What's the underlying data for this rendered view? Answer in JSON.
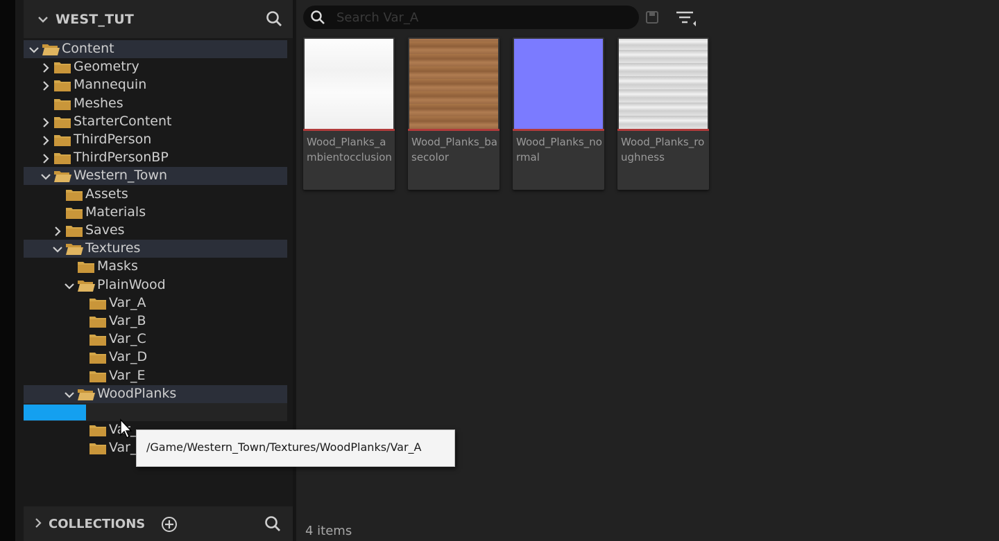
{
  "sidebar": {
    "title": "WEST_TUT",
    "tree": [
      {
        "label": "Content",
        "arrow": "down",
        "indent": 0,
        "open": true,
        "hl": true
      },
      {
        "label": "Geometry",
        "arrow": "right",
        "indent": 1
      },
      {
        "label": "Mannequin",
        "arrow": "right",
        "indent": 1
      },
      {
        "label": "Meshes",
        "arrow": "none",
        "indent": 1
      },
      {
        "label": "StarterContent",
        "arrow": "right",
        "indent": 1
      },
      {
        "label": "ThirdPerson",
        "arrow": "right",
        "indent": 1
      },
      {
        "label": "ThirdPersonBP",
        "arrow": "right",
        "indent": 1
      },
      {
        "label": "Western_Town",
        "arrow": "down",
        "indent": 1,
        "open": true,
        "hl": true
      },
      {
        "label": "Assets",
        "arrow": "none",
        "indent": 2
      },
      {
        "label": "Materials",
        "arrow": "none",
        "indent": 2
      },
      {
        "label": "Saves",
        "arrow": "right",
        "indent": 2
      },
      {
        "label": "Textures",
        "arrow": "down",
        "indent": 2,
        "open": true,
        "hl": true
      },
      {
        "label": "Masks",
        "arrow": "none",
        "indent": 3
      },
      {
        "label": "PlainWood",
        "arrow": "down",
        "indent": 3,
        "open": true
      },
      {
        "label": "Var_A",
        "arrow": "none",
        "indent": 4
      },
      {
        "label": "Var_B",
        "arrow": "none",
        "indent": 4
      },
      {
        "label": "Var_C",
        "arrow": "none",
        "indent": 4
      },
      {
        "label": "Var_D",
        "arrow": "none",
        "indent": 4
      },
      {
        "label": "Var_E",
        "arrow": "none",
        "indent": 4
      },
      {
        "label": "WoodPlanks",
        "arrow": "down",
        "indent": 3,
        "open": true,
        "hl": true
      },
      {
        "label": "",
        "arrow": "none",
        "indent": 4,
        "selected": true
      },
      {
        "label": "Var_",
        "arrow": "none",
        "indent": 4
      },
      {
        "label": "Var_",
        "arrow": "none",
        "indent": 4
      }
    ],
    "collections_label": "COLLECTIONS"
  },
  "content": {
    "search_placeholder": "Search Var_A",
    "assets": [
      {
        "name": "Wood_Planks_ambientocclusion",
        "thumb": "ao"
      },
      {
        "name": "Wood_Planks_basecolor",
        "thumb": "basecolor"
      },
      {
        "name": "Wood_Planks_normal",
        "thumb": "normal"
      },
      {
        "name": "Wood_Planks_roughness",
        "thumb": "roughness"
      }
    ],
    "item_count": "4 items"
  },
  "tooltip": "/Game/Western_Town/Textures/WoodPlanks/Var_A",
  "colors": {
    "selection": "#14a0f0",
    "folder": "#d4a648",
    "normal_map": "#7b7bff",
    "texture_bar": "#b13b3b"
  }
}
